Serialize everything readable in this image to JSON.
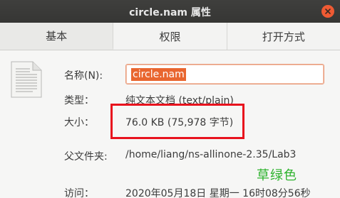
{
  "window": {
    "title": "circle.nam 属性"
  },
  "tabs": [
    {
      "label": "基本",
      "active": true
    },
    {
      "label": "权限",
      "active": false
    },
    {
      "label": "打开方式",
      "active": false
    }
  ],
  "basic": {
    "name_label": "名称(N):",
    "name_value": "circle.nam",
    "type_label": "类型：",
    "type_value": "纯文本文档 (text/plain)",
    "size_label": "大小：",
    "size_value": "76.0 KB (75,978 字节)",
    "parent_label": "父文件夹:",
    "parent_value": "/home/liang/ns-allinone-2.35/Lab3",
    "accessed_label": "访问：",
    "accessed_value": "2020年05月18日 星期一 16时08分56秒"
  },
  "annotation": {
    "watermark_text": "草绿色",
    "highlight_color": "#e8121d",
    "watermark_color": "#2eb32e"
  },
  "colors": {
    "titlebar": "#3a3a38",
    "close_button": "#ef5a33",
    "selection": "#e9662f"
  },
  "icons": {
    "close": "close-icon",
    "file": "text-file-icon"
  }
}
